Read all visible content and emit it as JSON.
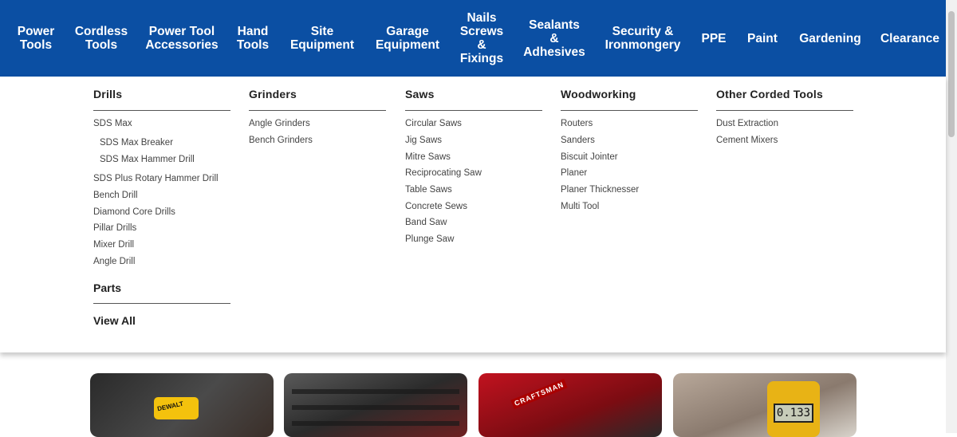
{
  "nav": {
    "items": [
      {
        "label": "Power\nTools"
      },
      {
        "label": "Cordless\nTools"
      },
      {
        "label": "Power Tool\nAccessories"
      },
      {
        "label": "Hand\nTools"
      },
      {
        "label": "Site\nEquipment"
      },
      {
        "label": "Garage\nEquipment"
      },
      {
        "label": "Nails\nScrews\n&\nFixings"
      },
      {
        "label": "Sealants\n&\nAdhesives"
      },
      {
        "label": "Security &\nIronmongery"
      },
      {
        "label": "PPE"
      },
      {
        "label": "Paint"
      },
      {
        "label": "Gardening"
      },
      {
        "label": "Clearance"
      }
    ]
  },
  "menu": {
    "columns": [
      {
        "heading": "Drills",
        "links": [
          {
            "label": "SDS Max"
          },
          {
            "label": "SDS Max Breaker"
          },
          {
            "label": "SDS Max Hammer Drill"
          },
          {
            "label": "SDS Plus Rotary Hammer Drill"
          },
          {
            "label": "Bench Drill"
          },
          {
            "label": "Diamond Core Drills"
          },
          {
            "label": "Pillar Drills"
          },
          {
            "label": "Mixer Drill"
          },
          {
            "label": "Angle Drill"
          }
        ],
        "parts": "Parts",
        "view_all": "View All"
      },
      {
        "heading": "Grinders",
        "links": [
          {
            "label": "Angle Grinders"
          },
          {
            "label": "Bench Grinders"
          }
        ]
      },
      {
        "heading": "Saws",
        "links": [
          {
            "label": "Circular Saws"
          },
          {
            "label": "Jig Saws"
          },
          {
            "label": "Mitre Saws"
          },
          {
            "label": "Reciprocating Saw"
          },
          {
            "label": "Table Saws"
          },
          {
            "label": "Concrete Sews"
          },
          {
            "label": "Band Saw"
          },
          {
            "label": "Plunge Saw"
          }
        ]
      },
      {
        "heading": "Woodworking",
        "links": [
          {
            "label": "Routers"
          },
          {
            "label": "Sanders"
          },
          {
            "label": "Biscuit Jointer"
          },
          {
            "label": "Planer"
          },
          {
            "label": "Planer Thicknesser"
          },
          {
            "label": "Multi Tool"
          }
        ]
      },
      {
        "heading": "Other Corded Tools",
        "links": [
          {
            "label": "Dust Extraction"
          },
          {
            "label": "Cement Mixers"
          }
        ]
      }
    ]
  },
  "cards": {
    "card1_brand": "DEWALT",
    "card3_brand": "CRAFTSMAN",
    "card4_meter_reading": "0.133"
  },
  "colors": {
    "nav_bg": "#0b4fa3",
    "nav_text": "#ffffff",
    "heading_text": "#222222",
    "link_text": "#444444"
  }
}
